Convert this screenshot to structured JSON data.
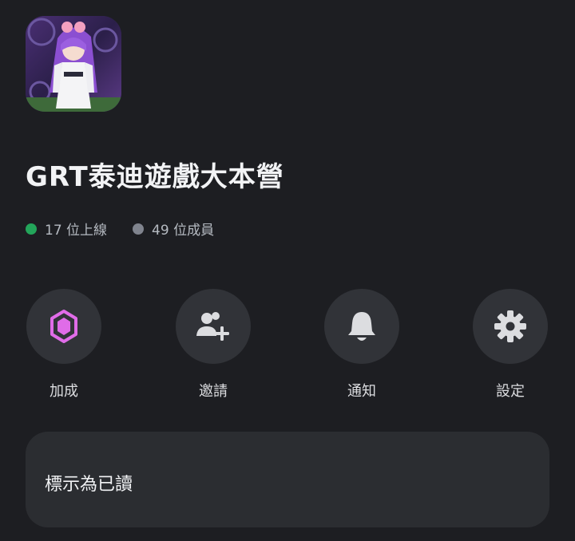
{
  "server": {
    "name": "GRT泰迪遊戲大本營",
    "online_count": "17 位上線",
    "member_count": "49 位成員"
  },
  "colors": {
    "online": "#23a55a",
    "offline": "#80848e",
    "boost": "#e06ce8"
  },
  "actions": [
    {
      "label": "加成",
      "icon": "boost-gem-icon"
    },
    {
      "label": "邀請",
      "icon": "invite-user-icon"
    },
    {
      "label": "通知",
      "icon": "bell-icon"
    },
    {
      "label": "設定",
      "icon": "gear-icon"
    }
  ],
  "menu": {
    "mark_read": "標示為已讀"
  }
}
